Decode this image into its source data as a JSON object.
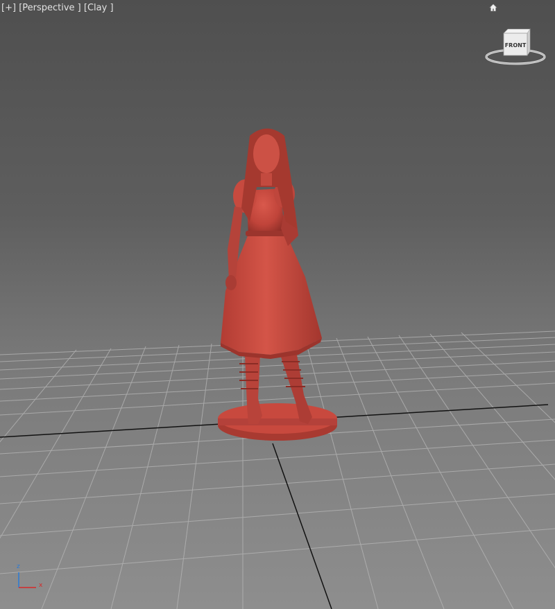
{
  "viewport": {
    "label_plus": "[+]",
    "label_view": "[Perspective ]",
    "label_shading": "[Clay ]",
    "viewcube_face": "FRONT",
    "axis_z": "z",
    "axis_x": "x"
  },
  "icons": {
    "home": "home-icon",
    "viewcube": "viewcube-icon"
  },
  "colors": {
    "model": "#c0443a",
    "grid": "#b4b4b4",
    "axis_line": "#111111"
  }
}
